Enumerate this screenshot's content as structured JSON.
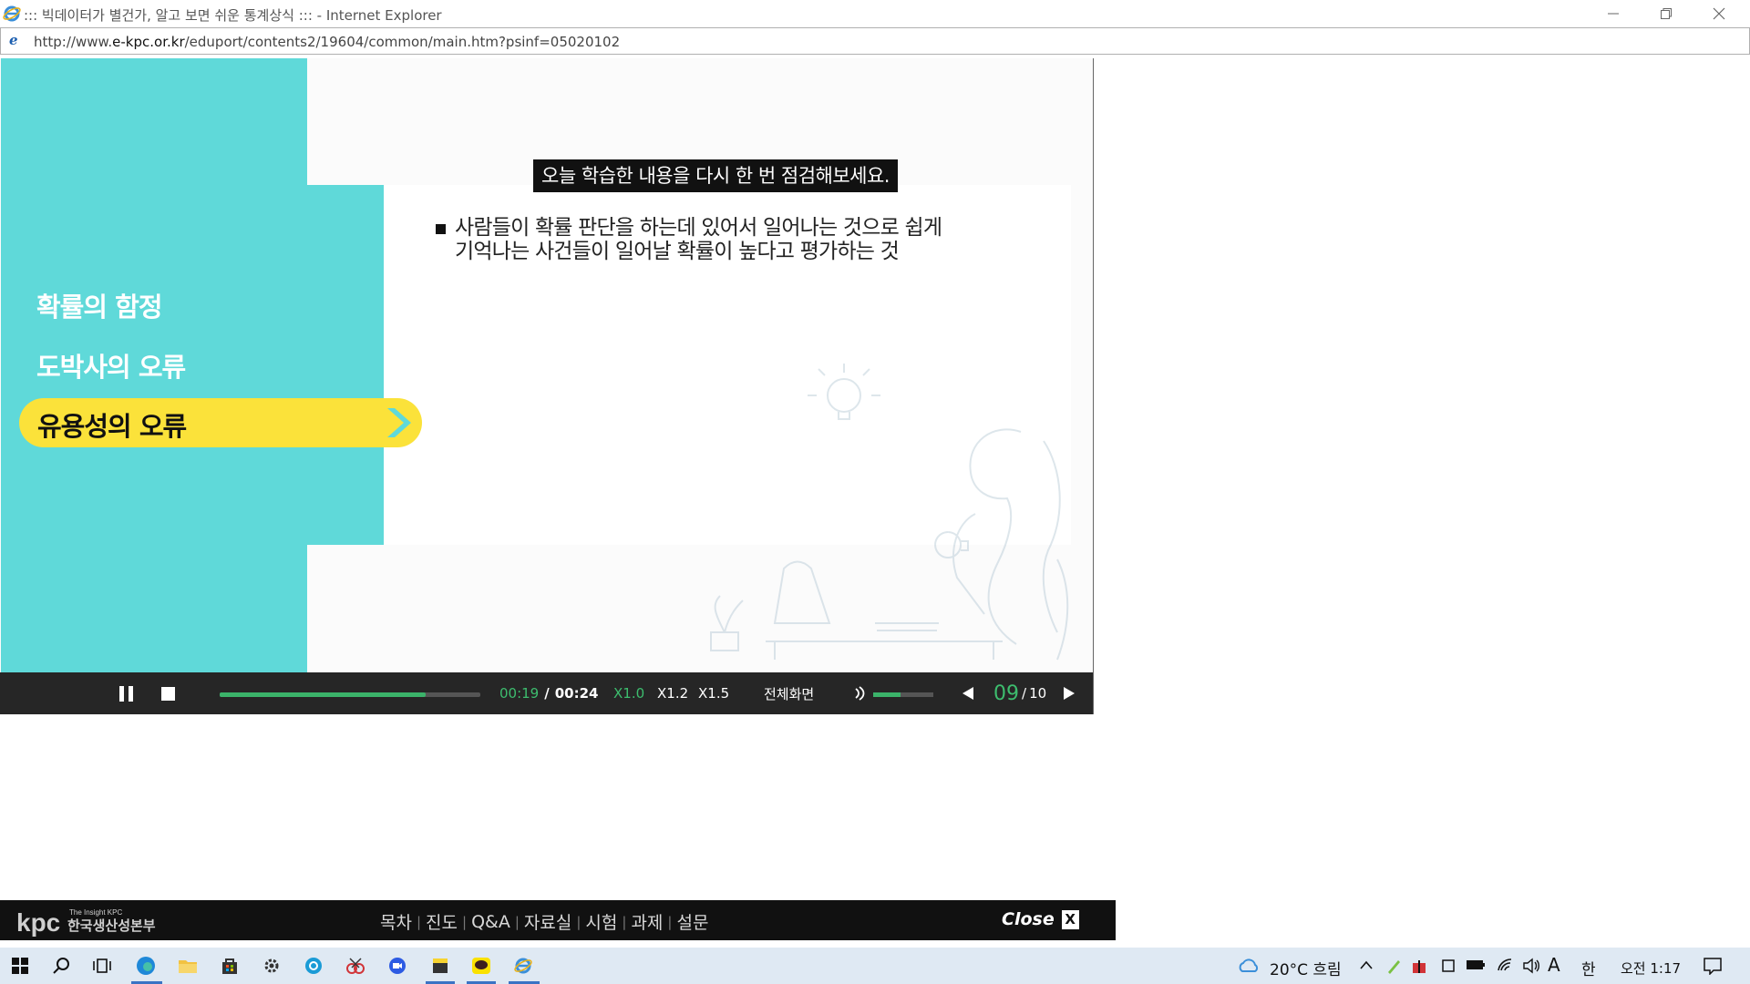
{
  "window": {
    "title": "::: 빅데이터가 별건가, 알고 보면 쉬운 통계상식 ::: - Internet Explorer",
    "minimize_icon": "minimize-icon",
    "restore_icon": "restore-icon",
    "close_icon": "close-icon"
  },
  "address": {
    "prefix": "http://www.",
    "domain": "e-kpc.or.kr",
    "path": "/eduport/contents2/19604/common/main.htm?psinf=05020102"
  },
  "course": {
    "menu": [
      {
        "label": "확률의 함정"
      },
      {
        "label": "도박사의 오류"
      },
      {
        "label": "유용성의 오류",
        "active": true
      }
    ],
    "prompt": "오늘 학습한 내용을 다시 한 번 점검해보세요.",
    "bullet_line1": "사람들이 확률 판단을 하는데 있어서 일어나는 것으로 쉽게",
    "bullet_line2": "기억나는 사건들이 일어날 확률이 높다고 평가하는 것",
    "accent_teal": "#5fd9d9",
    "accent_yellow": "#fbe23a"
  },
  "player": {
    "current_time": "00:19",
    "separator": "/",
    "total_time": "00:24",
    "progress_fraction": 0.79,
    "speed_options": [
      "X1.0",
      "X1.2",
      "X1.5"
    ],
    "selected_speed": "X1.0",
    "fullscreen_label": "전체화면",
    "volume_fraction": 0.45,
    "page_current": "09",
    "page_sep": "/",
    "page_total": "10",
    "accent_green": "#3dbd6e"
  },
  "bottom_bar": {
    "logo_tagline": "The Insight KPC",
    "logo_wordmark": "kpc",
    "logo_org": "한국생산성본부",
    "links": [
      "목차",
      "진도",
      "Q&A",
      "자료실",
      "시험",
      "과제",
      "설문"
    ],
    "close_label": "Close",
    "close_x": "X"
  },
  "taskbar": {
    "weather": "20°C 흐림",
    "ime_a": "A",
    "ime_lang": "한",
    "clock": "오전 1:17"
  }
}
